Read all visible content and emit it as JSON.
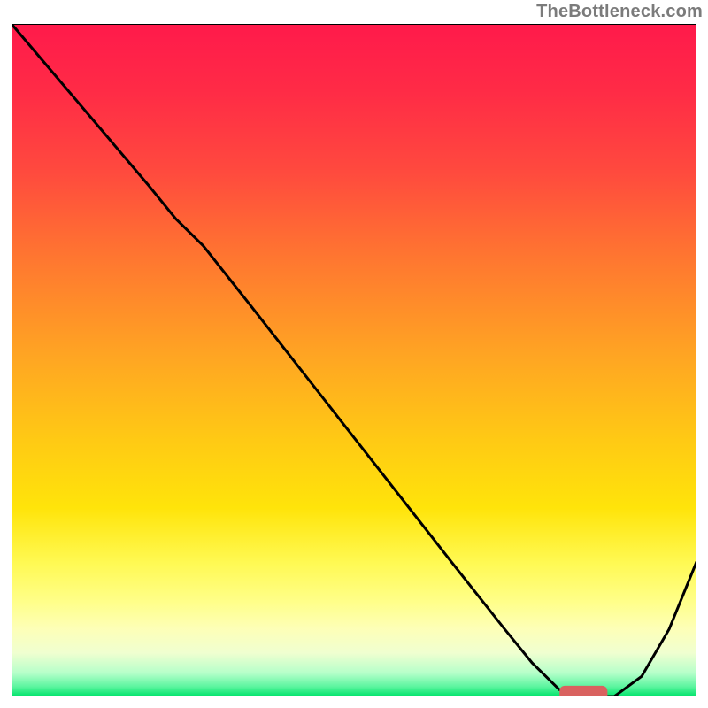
{
  "watermark": "TheBottleneck.com",
  "colors": {
    "gradient_stops": [
      {
        "offset": 0.0,
        "color": "#ff1a4b"
      },
      {
        "offset": 0.1,
        "color": "#ff2b46"
      },
      {
        "offset": 0.22,
        "color": "#ff4a3e"
      },
      {
        "offset": 0.35,
        "color": "#ff7730"
      },
      {
        "offset": 0.5,
        "color": "#ffa722"
      },
      {
        "offset": 0.62,
        "color": "#ffca14"
      },
      {
        "offset": 0.72,
        "color": "#ffe40a"
      },
      {
        "offset": 0.8,
        "color": "#fff952"
      },
      {
        "offset": 0.86,
        "color": "#ffff8a"
      },
      {
        "offset": 0.9,
        "color": "#fdffb8"
      },
      {
        "offset": 0.935,
        "color": "#f0ffd0"
      },
      {
        "offset": 0.965,
        "color": "#b6ffca"
      },
      {
        "offset": 0.985,
        "color": "#5df5a0"
      },
      {
        "offset": 1.0,
        "color": "#00e36a"
      }
    ],
    "curve_stroke": "#000000",
    "marker_fill": "#d9625f",
    "border_stroke": "#000000"
  },
  "chart_data": {
    "type": "line",
    "title": "",
    "xlabel": "",
    "ylabel": "",
    "xlim": [
      0,
      100
    ],
    "ylim": [
      0,
      100
    ],
    "x": [
      0,
      5,
      10,
      15,
      20,
      24,
      28,
      35,
      45,
      55,
      65,
      72,
      76,
      80,
      84,
      88,
      92,
      96,
      100
    ],
    "values": [
      100,
      94,
      88,
      82,
      76,
      71,
      67,
      58,
      45,
      32,
      19,
      10,
      5,
      1,
      0,
      0,
      3,
      10,
      20
    ],
    "marker": {
      "x_start": 80,
      "x_end": 87,
      "y": 0.5,
      "thickness": 2.2
    }
  }
}
